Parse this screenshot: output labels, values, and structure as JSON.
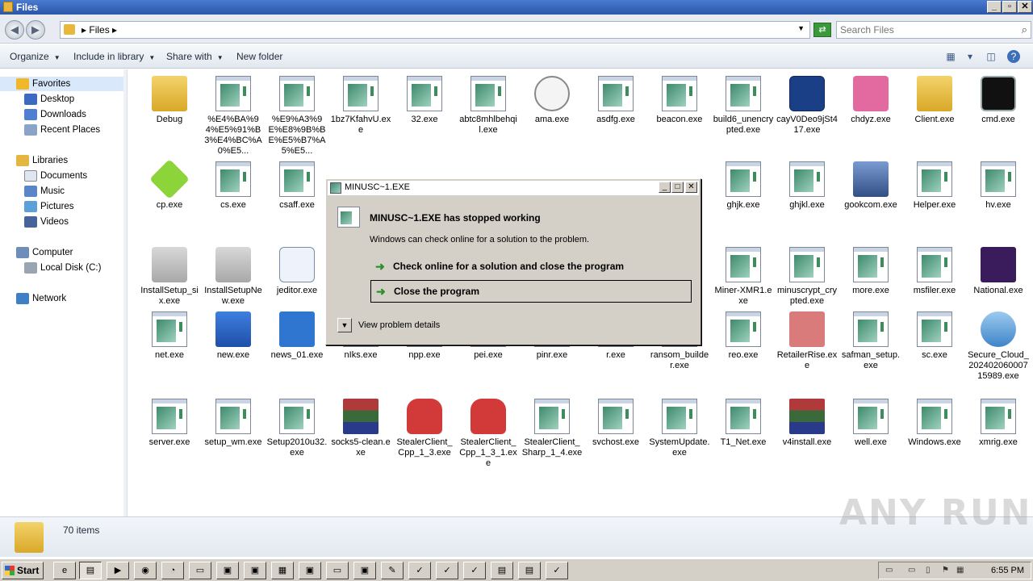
{
  "window": {
    "title": "Files"
  },
  "address": {
    "crumb": "Files",
    "search_placeholder": "Search Files"
  },
  "toolbar": {
    "organize": "Organize",
    "include": "Include in library",
    "share": "Share with",
    "new_folder": "New folder"
  },
  "sidebar": {
    "favorites": "Favorites",
    "desktop": "Desktop",
    "downloads": "Downloads",
    "recent": "Recent Places",
    "libraries": "Libraries",
    "documents": "Documents",
    "music": "Music",
    "pictures": "Pictures",
    "videos": "Videos",
    "computer": "Computer",
    "local_disk": "Local Disk (C:)",
    "network": "Network"
  },
  "files": [
    {
      "name": "Debug",
      "icon": "folder"
    },
    {
      "name": "%E4%BA%94%E5%91%B3%E4%BC%A0%E5...",
      "icon": "exe"
    },
    {
      "name": "%E9%A3%9E%E8%9B%BE%E5%B7%A5%E5...",
      "icon": "exe"
    },
    {
      "name": "1bz7KfahvU.exe",
      "icon": "exe"
    },
    {
      "name": "32.exe",
      "icon": "exe"
    },
    {
      "name": "abtc8mhlbehqil.exe",
      "icon": "exe"
    },
    {
      "name": "ama.exe",
      "icon": "gauge"
    },
    {
      "name": "asdfg.exe",
      "icon": "exe"
    },
    {
      "name": "beacon.exe",
      "icon": "exe"
    },
    {
      "name": "build6_unencrypted.exe",
      "icon": "exe"
    },
    {
      "name": "cayV0Deo9jSt417.exe",
      "icon": "network"
    },
    {
      "name": "chdyz.exe",
      "icon": "dice"
    },
    {
      "name": "Client.exe",
      "icon": "folder"
    },
    {
      "name": "cmd.exe",
      "icon": "console"
    },
    {
      "name": "cp.exe",
      "icon": "cube"
    },
    {
      "name": "cs.exe",
      "icon": "exe"
    },
    {
      "name": "csaff.exe",
      "icon": "exe"
    },
    {
      "name": "ghjk.exe",
      "icon": "exe"
    },
    {
      "name": "ghjkl.exe",
      "icon": "exe"
    },
    {
      "name": "gookcom.exe",
      "icon": "installer"
    },
    {
      "name": "Helper.exe",
      "icon": "exe"
    },
    {
      "name": "hv.exe",
      "icon": "exe"
    },
    {
      "name": "InstallSetup_six.exe",
      "icon": "lock"
    },
    {
      "name": "InstallSetupNew.exe",
      "icon": "lock"
    },
    {
      "name": "jeditor.exe",
      "icon": "notepad"
    },
    {
      "name": "Miner-XMR1.exe",
      "icon": "exe"
    },
    {
      "name": "minuscrypt_crypted.exe",
      "icon": "exe"
    },
    {
      "name": "more.exe",
      "icon": "exe"
    },
    {
      "name": "msfiler.exe",
      "icon": "exe"
    },
    {
      "name": "National.exe",
      "icon": "lotus"
    },
    {
      "name": "net.exe",
      "icon": "exe"
    },
    {
      "name": "new.exe",
      "icon": "blue"
    },
    {
      "name": "news_01.exe",
      "icon": "news"
    },
    {
      "name": "nIks.exe",
      "icon": "exe"
    },
    {
      "name": "npp.exe",
      "icon": "exe"
    },
    {
      "name": "pei.exe",
      "icon": "exe"
    },
    {
      "name": "pinr.exe",
      "icon": "exe"
    },
    {
      "name": "r.exe",
      "icon": "exe"
    },
    {
      "name": "ransom_builder.exe",
      "icon": "exe"
    },
    {
      "name": "reo.exe",
      "icon": "exe"
    },
    {
      "name": "RetailerRise.exe",
      "icon": "pinkbox"
    },
    {
      "name": "safman_setup.exe",
      "icon": "exe"
    },
    {
      "name": "sc.exe",
      "icon": "exe"
    },
    {
      "name": "Secure_Cloud_20240206000715989.exe",
      "icon": "setup"
    },
    {
      "name": "server.exe",
      "icon": "exe"
    },
    {
      "name": "setup_wm.exe",
      "icon": "exe"
    },
    {
      "name": "Setup2010u32.exe",
      "icon": "exe"
    },
    {
      "name": "socks5-clean.exe",
      "icon": "winrar"
    },
    {
      "name": "StealerClient_Cpp_1_3.exe",
      "icon": "mitten"
    },
    {
      "name": "StealerClient_Cpp_1_3_1.exe",
      "icon": "mitten"
    },
    {
      "name": "StealerClient_Sharp_1_4.exe",
      "icon": "exe"
    },
    {
      "name": "svchost.exe",
      "icon": "exe"
    },
    {
      "name": "SystemUpdate.exe",
      "icon": "exe-shield"
    },
    {
      "name": "T1_Net.exe",
      "icon": "exe"
    },
    {
      "name": "v4install.exe",
      "icon": "winrar"
    },
    {
      "name": "well.exe",
      "icon": "exe"
    },
    {
      "name": "Windows.exe",
      "icon": "exe"
    },
    {
      "name": "xmrig.exe",
      "icon": "exe"
    }
  ],
  "status": {
    "count": "70 items"
  },
  "watermark": "ANY RUN",
  "dialog": {
    "title": "MINUSC~1.EXE",
    "heading": "MINUSC~1.EXE has stopped working",
    "sub": "Windows can check online for a solution to the problem.",
    "option1": "Check online for a solution and close the program",
    "option2": "Close the program",
    "details": "View problem details"
  },
  "taskbar": {
    "start": "Start",
    "clock": "6:55 PM"
  }
}
